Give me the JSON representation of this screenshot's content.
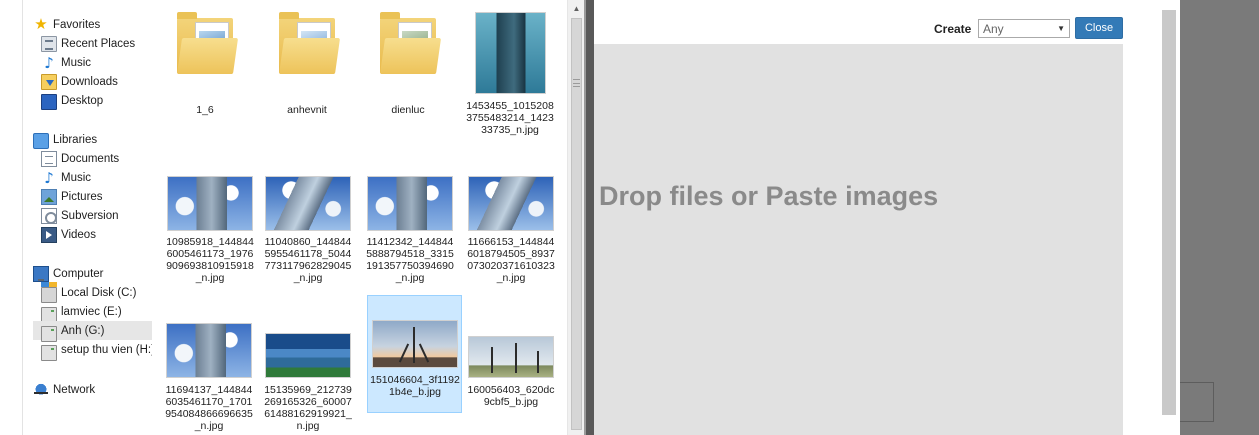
{
  "navigation": {
    "favorites": {
      "label": "Favorites",
      "icon": "star-icon"
    },
    "favorite_items": [
      {
        "label": "Recent Places",
        "icon": "recent-places-icon"
      },
      {
        "label": "Music",
        "icon": "music-icon"
      },
      {
        "label": "Downloads",
        "icon": "downloads-icon"
      },
      {
        "label": "Desktop",
        "icon": "desktop-icon"
      }
    ],
    "libraries": {
      "label": "Libraries",
      "icon": "libraries-icon"
    },
    "library_items": [
      {
        "label": "Documents",
        "icon": "documents-icon"
      },
      {
        "label": "Music",
        "icon": "music-icon"
      },
      {
        "label": "Pictures",
        "icon": "pictures-icon"
      },
      {
        "label": "Subversion",
        "icon": "subversion-icon"
      },
      {
        "label": "Videos",
        "icon": "videos-icon"
      }
    ],
    "computer": {
      "label": "Computer",
      "icon": "computer-icon"
    },
    "drives": [
      {
        "label": "Local Disk (C:)",
        "icon": "local-disk-icon"
      },
      {
        "label": "lamviec (E:)",
        "icon": "drive-icon"
      },
      {
        "label": "Anh (G:)",
        "icon": "drive-icon",
        "selected": true
      },
      {
        "label": "setup thu vien (H:)",
        "icon": "drive-icon"
      }
    ],
    "network": {
      "label": "Network",
      "icon": "network-icon"
    }
  },
  "files": [
    {
      "name": "1_6",
      "kind": "folder"
    },
    {
      "name": "anhevnit",
      "kind": "folder"
    },
    {
      "name": "dienluc",
      "kind": "folder"
    },
    {
      "name": "1453455_10152083755483214_142333735_n.jpg",
      "kind": "image"
    },
    {
      "name": "10985918_1448446005461173_1976909693810915918_n.jpg",
      "kind": "image"
    },
    {
      "name": "11040860_1448445955461178_5044773117962829045_n.jpg",
      "kind": "image"
    },
    {
      "name": "11412342_1448445888794518_3315191357750394690_n.jpg",
      "kind": "image"
    },
    {
      "name": "11666153_1448446018794505_8937073020371610323_n.jpg",
      "kind": "image"
    },
    {
      "name": "11694137_1448446035461170_1701954084866696635_n.jpg",
      "kind": "image"
    },
    {
      "name": "15135969_212739269165326_6000761488162919921_n.jpg",
      "kind": "image"
    },
    {
      "name": "151046604_3f11921b4e_b.jpg",
      "kind": "image",
      "selected": true
    },
    {
      "name": "160056403_620dc9cbf5_b.jpg",
      "kind": "image"
    }
  ],
  "uploader": {
    "create_label": "Create",
    "create_value": "Any",
    "close_label": "Close",
    "drop_text": "Drop files or Paste images",
    "accent_color": "#337ab7"
  }
}
